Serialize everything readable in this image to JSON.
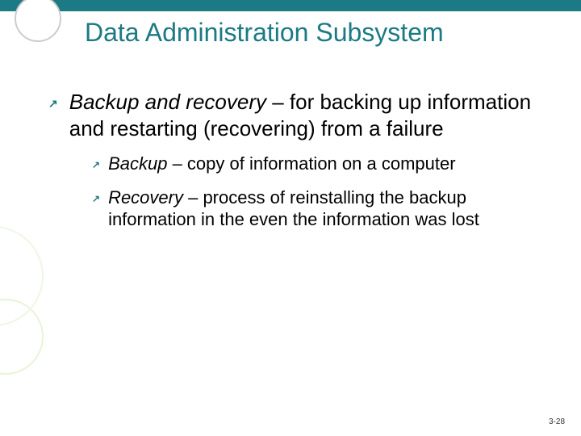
{
  "title": "Data Administration Subsystem",
  "main": {
    "term": "Backup and recovery",
    "desc": " – for backing up information and restarting (recovering) from a failure"
  },
  "subs": [
    {
      "term": "Backup",
      "desc": " – copy of information on a computer"
    },
    {
      "term": "Recovery",
      "desc": " – process of reinstalling the backup information in the even the information was lost"
    }
  ],
  "page": "3-28"
}
